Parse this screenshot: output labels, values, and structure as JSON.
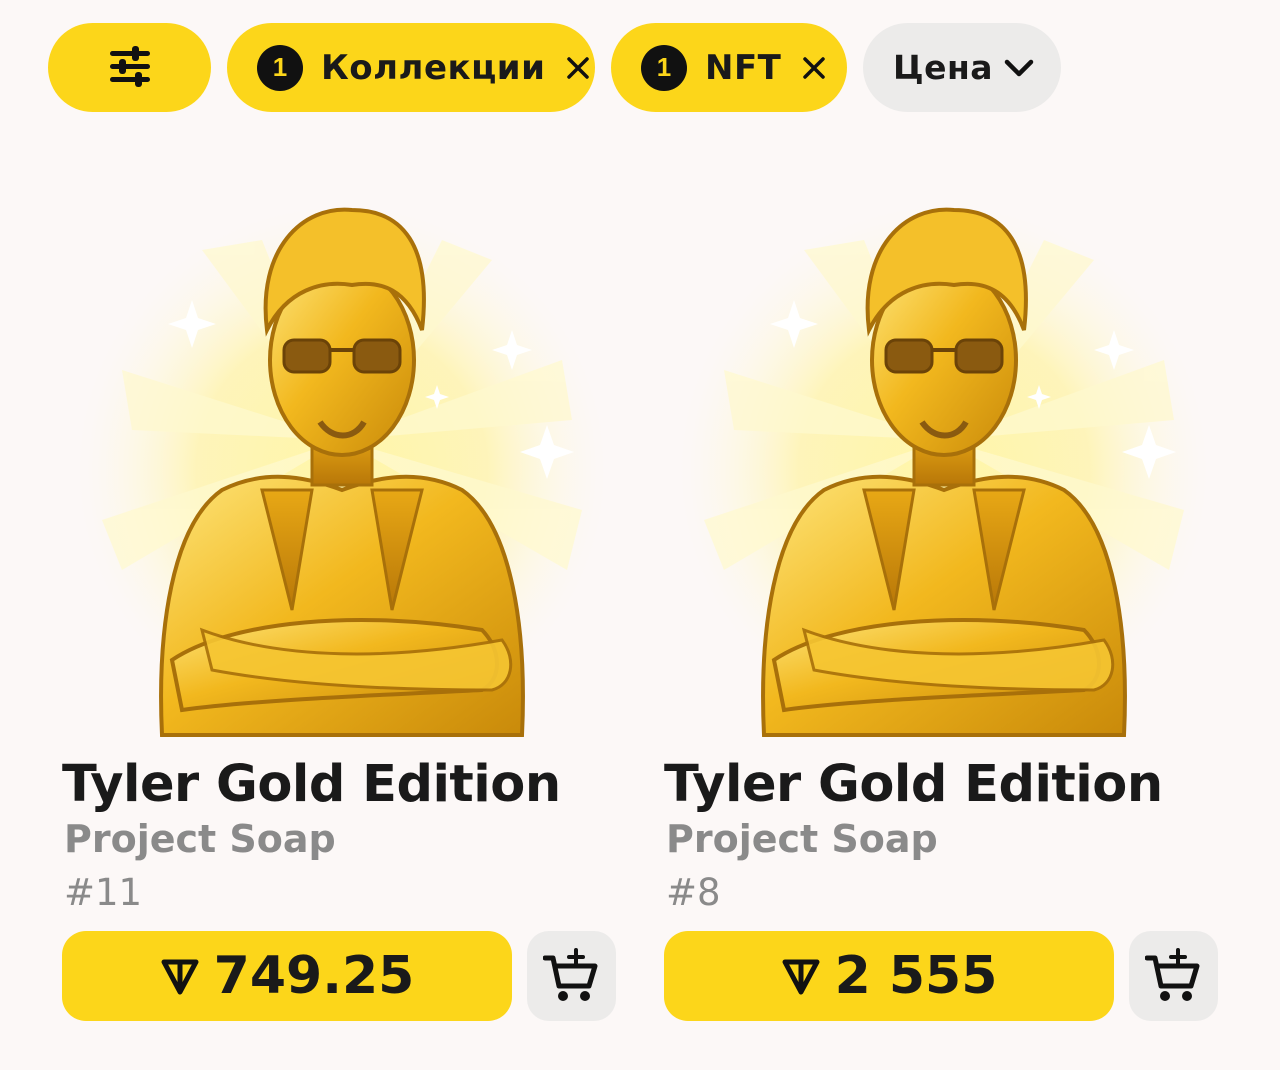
{
  "filters": {
    "settings_icon": "sliders-icon",
    "collections": {
      "count": "1",
      "label": "Коллекции"
    },
    "nft": {
      "count": "1",
      "label": "NFT"
    },
    "price": {
      "label": "Цена"
    }
  },
  "colors": {
    "accent": "#fcd61a",
    "background": "#fcf8f7",
    "secondary_button": "#ecebea",
    "muted_text": "#8a8a8a"
  },
  "cards": [
    {
      "title": "Tyler Gold Edition",
      "collection": "Project Soap",
      "number": "#11",
      "price": "749.25",
      "currency_icon": "ton-icon",
      "cart_icon": "cart-add-icon"
    },
    {
      "title": "Tyler Gold Edition",
      "collection": "Project Soap",
      "number": "#8",
      "price": "2 555",
      "currency_icon": "ton-icon",
      "cart_icon": "cart-add-icon"
    }
  ]
}
